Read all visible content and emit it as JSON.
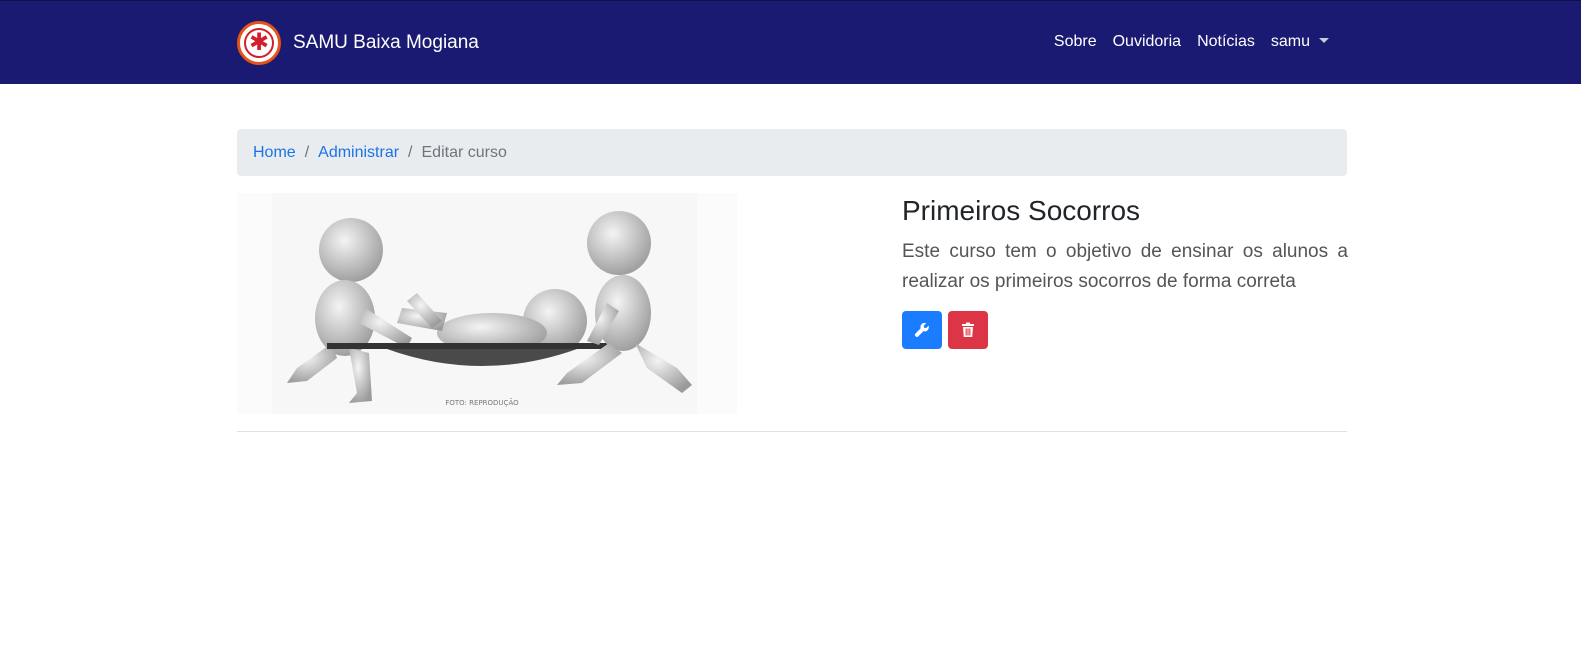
{
  "navbar": {
    "brand": "SAMU Baixa Mogiana",
    "links": [
      "Sobre",
      "Ouvidoria",
      "Notícias"
    ],
    "user_menu": "samu",
    "bg_color": "#1a1a72"
  },
  "breadcrumb": {
    "items": [
      "Home",
      "Administrar"
    ],
    "active": "Editar curso"
  },
  "course": {
    "title": "Primeiros Socorros",
    "description": "Este curso tem o objetivo de ensinar os alunos a realizar os primeiros socorros de forma correta",
    "image_caption": "FOTO: REPRODUÇÃO"
  },
  "actions": {
    "edit_icon": "wrench-icon",
    "delete_icon": "trash-icon",
    "edit_color": "#1a7dff",
    "delete_color": "#dc3545"
  }
}
